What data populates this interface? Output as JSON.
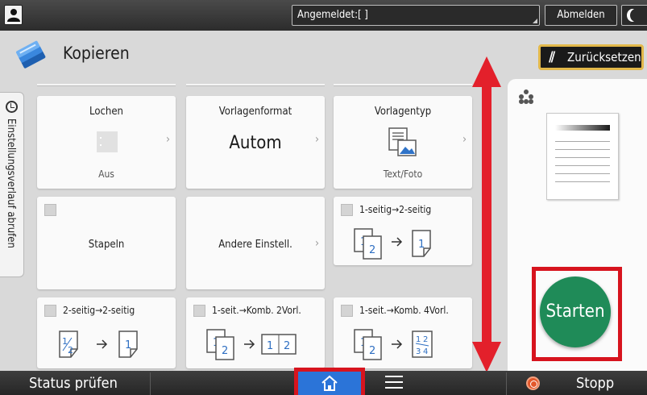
{
  "topbar": {
    "login_status": "Angemeldet:[ ]",
    "logout_label": "Abmelden"
  },
  "header": {
    "app_title": "Kopieren",
    "reset_label": "Zurücksetzen"
  },
  "history_tab": {
    "label": "Einstellungsverlauf abrufen"
  },
  "tiles": {
    "lochen": {
      "title": "Lochen",
      "value": "Aus"
    },
    "vorlagenformat": {
      "title": "Vorlagenformat",
      "value": "Autom"
    },
    "vorlagentyp": {
      "title": "Vorlagentyp",
      "value": "Text/Foto"
    },
    "stapeln": {
      "title": "Stapeln"
    },
    "andere": {
      "title": "Andere Einstell."
    },
    "duplex_1_2": {
      "label": "1-seitig→2-seitig"
    },
    "duplex_2_2": {
      "label": "2-seitig→2-seitig"
    },
    "komb_2": {
      "label": "1-seit.→Komb. 2Vorl."
    },
    "komb_4": {
      "label": "1-seit.→Komb. 4Vorl."
    }
  },
  "start": {
    "label": "Starten"
  },
  "bottombar": {
    "status_label": "Status prüfen",
    "stop_label": "Stopp"
  },
  "colors": {
    "start_green": "#1f8b58",
    "highlight_red": "#d7141e",
    "reset_border": "#e2b84a",
    "home_blue": "#2b74d8"
  }
}
